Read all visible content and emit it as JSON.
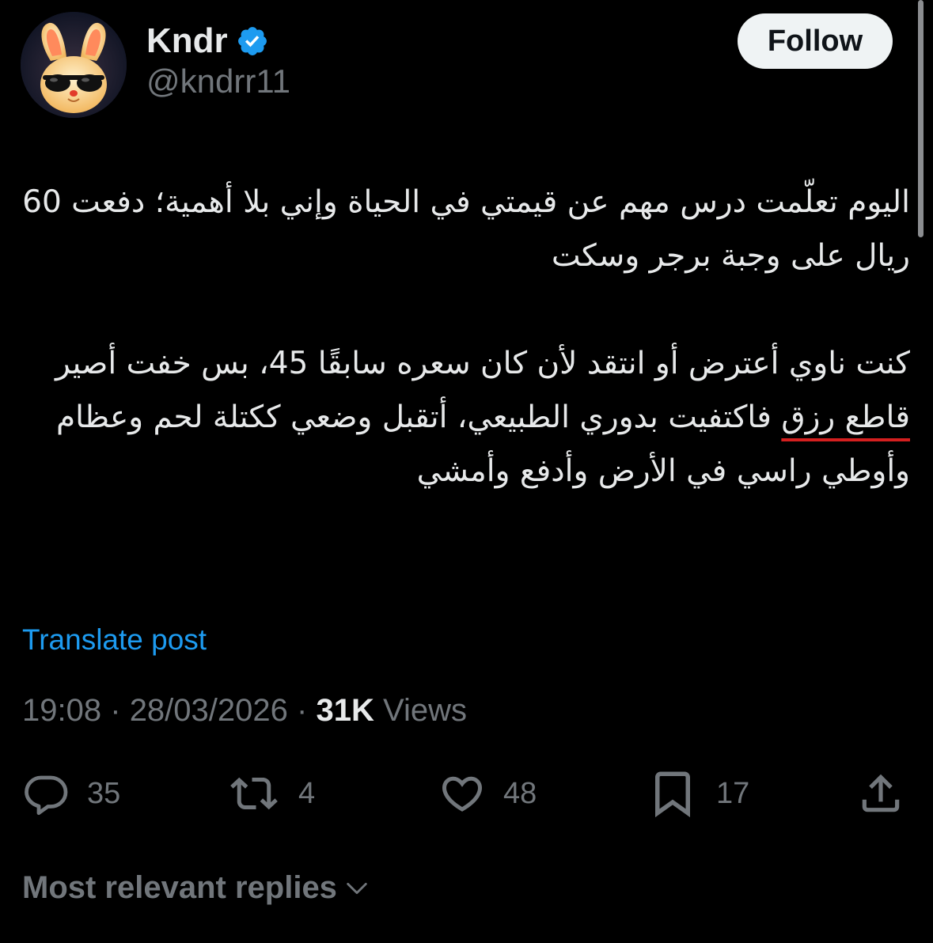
{
  "author": {
    "display_name": "Kndr",
    "handle": "@kndrr11",
    "verified": true,
    "avatar_icon": "bunny-sunglasses-avatar"
  },
  "follow_label": "Follow",
  "post": {
    "paragraph1": "اليوم تعلّمت درس مهم عن قيمتي في الحياة وإني بلا أهمية؛ دفعت 60 ريال على وجبة برجر وسكت",
    "paragraph2_before": "كنت ناوي أعترض أو انتقد لأن كان سعره سابقًا 45، بس خفت أصير ",
    "paragraph2_underlined": "قاطع رزق",
    "paragraph2_after": " فاكتفيت بدوري الطبيعي، أتقبل وضعي ككتلة لحم وعظام وأوطي راسي في الأرض وأدفع وأمشي"
  },
  "translate_label": "Translate post",
  "meta": {
    "time": "19:08",
    "separator": "·",
    "date": "28/03/2026",
    "views_count": "31K",
    "views_label": "Views"
  },
  "actions": {
    "replies": "35",
    "reposts": "4",
    "likes": "48",
    "bookmarks": "17"
  },
  "replies_sort_label": "Most relevant replies",
  "colors": {
    "background": "#000000",
    "text": "#e7e9ea",
    "muted": "#71767b",
    "link": "#1d9bf0",
    "verified": "#1d9bf0",
    "underline": "#d41f1f"
  }
}
